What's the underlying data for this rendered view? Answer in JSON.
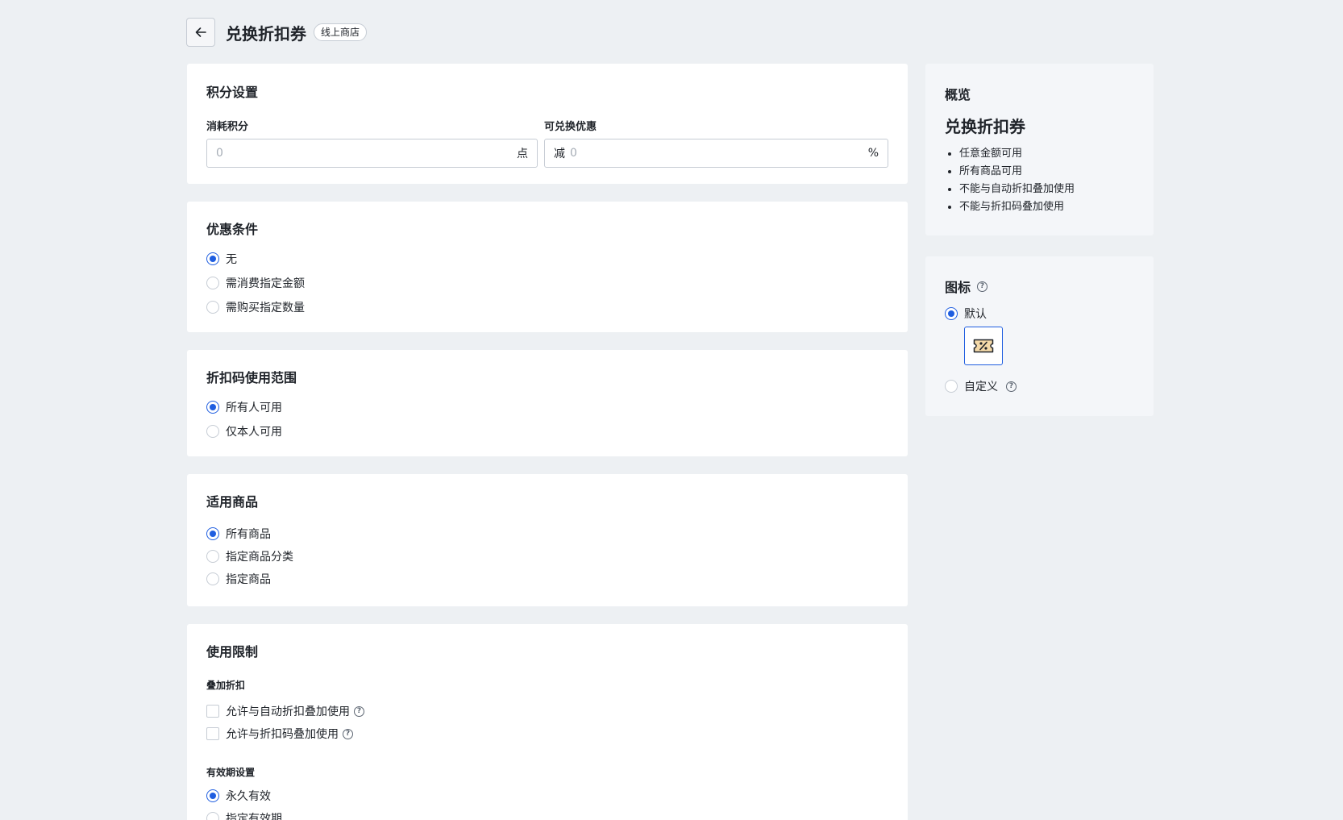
{
  "header": {
    "title": "兑换折扣券",
    "badge": "线上商店"
  },
  "points_settings": {
    "title": "积分设置",
    "cost_label": "消耗积分",
    "cost_placeholder": "0",
    "cost_suffix": "点",
    "discount_label": "可兑换优惠",
    "discount_prefix": "减",
    "discount_placeholder": "0",
    "discount_suffix": "%"
  },
  "conditions": {
    "title": "优惠条件",
    "options": [
      {
        "label": "无",
        "checked": true
      },
      {
        "label": "需消费指定金额",
        "checked": false
      },
      {
        "label": "需购买指定数量",
        "checked": false
      }
    ]
  },
  "code_scope": {
    "title": "折扣码使用范围",
    "options": [
      {
        "label": "所有人可用",
        "checked": true
      },
      {
        "label": "仅本人可用",
        "checked": false
      }
    ]
  },
  "products": {
    "title": "适用商品",
    "options": [
      {
        "label": "所有商品",
        "checked": true
      },
      {
        "label": "指定商品分类",
        "checked": false
      },
      {
        "label": "指定商品",
        "checked": false
      }
    ]
  },
  "limits": {
    "title": "使用限制",
    "stack_label": "叠加折扣",
    "stack_options": [
      {
        "label": "允许与自动折扣叠加使用",
        "checked": false
      },
      {
        "label": "允许与折扣码叠加使用",
        "checked": false
      }
    ],
    "validity_label": "有效期设置",
    "validity_options": [
      {
        "label": "永久有效",
        "checked": true
      },
      {
        "label": "指定有效期",
        "checked": false
      }
    ]
  },
  "overview": {
    "heading": "概览",
    "title": "兑换折扣券",
    "items": [
      "任意金额可用",
      "所有商品可用",
      "不能与自动折扣叠加使用",
      "不能与折扣码叠加使用"
    ]
  },
  "icon_settings": {
    "title": "图标",
    "default_label": "默认",
    "custom_label": "自定义",
    "default_icon": "discount-ticket-icon"
  },
  "colors": {
    "accent": "#1f5ee0",
    "background": "#edf0f3"
  }
}
